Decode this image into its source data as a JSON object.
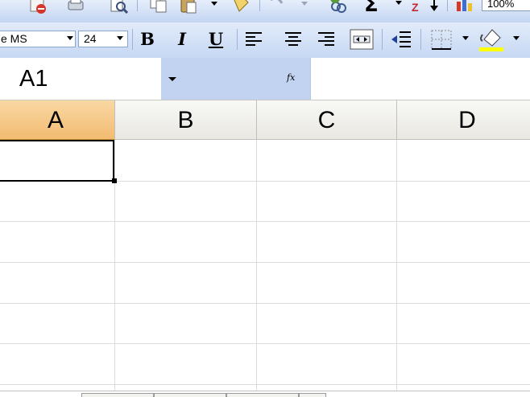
{
  "toolbar_standard": {
    "zoom_value": "100%",
    "icons": [
      "permission-icon",
      "print-icon",
      "print-preview-icon",
      "copy-icon",
      "paste-icon",
      "format-painter-icon",
      "undo-icon",
      "hyperlink-icon",
      "autosum-icon",
      "sort-icon",
      "chart-wizard-icon"
    ]
  },
  "toolbar_formatting": {
    "font_name": "e MS",
    "font_size": "24",
    "bold_label": "B",
    "italic_label": "I",
    "underline_label": "U"
  },
  "name_box": {
    "value": "A1",
    "fx_label": "fx"
  },
  "formula_bar": {
    "value": ""
  },
  "columns": [
    {
      "label": "A",
      "selected": true
    },
    {
      "label": "B",
      "selected": false
    },
    {
      "label": "C",
      "selected": false
    },
    {
      "label": "D",
      "selected": false
    }
  ],
  "colors": {
    "selected_header": "#f2bb70",
    "toolbar": "#c6d8f3",
    "gridline": "#dcdcd8"
  }
}
